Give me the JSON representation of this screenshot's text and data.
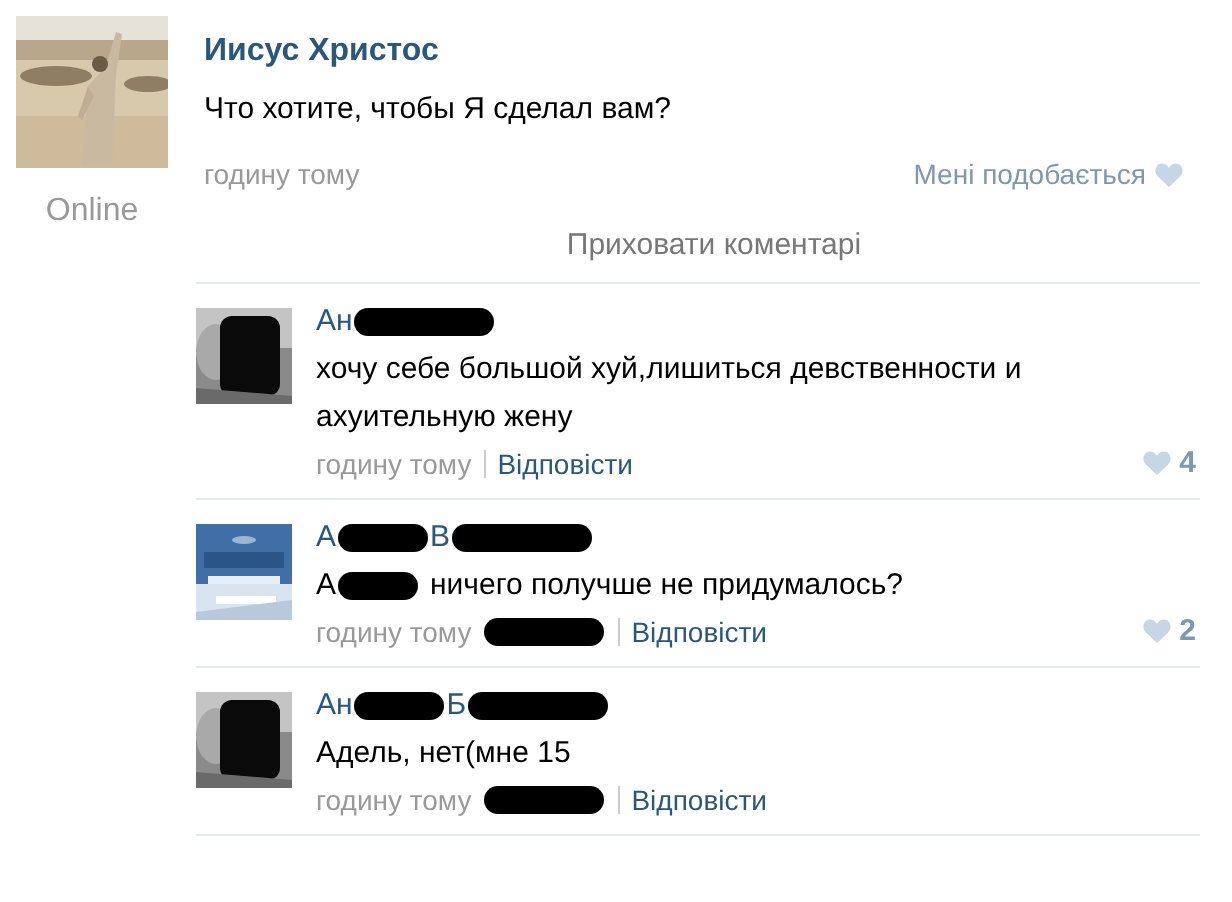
{
  "post": {
    "author": "Иисус Христос",
    "status": "Online",
    "text": "Что хотите, чтобы Я сделал вам?",
    "time": "годину тому",
    "like_label": "Мені подобається",
    "liked": false
  },
  "toggle_comments": "Приховати коментарі",
  "comments": [
    {
      "name_parts": [
        "Ан"
      ],
      "text_parts": [
        "хочу себе большой хуй,лишиться девственности и ахуительную жену"
      ],
      "time": "годину тому",
      "addressed": false,
      "reply": "Відповісти",
      "likes": "4"
    },
    {
      "name_parts": [
        "А",
        "В"
      ],
      "text_parts": [
        "А",
        "ничего получше не придумалось?"
      ],
      "time": "годину тому",
      "addressed": true,
      "reply": "Відповісти",
      "likes": "2"
    },
    {
      "name_parts": [
        "Ан",
        "Б"
      ],
      "text_parts": [
        "Адель, нет(мне 15"
      ],
      "time": "годину тому",
      "addressed": true,
      "reply": "Відповісти"
    }
  ]
}
